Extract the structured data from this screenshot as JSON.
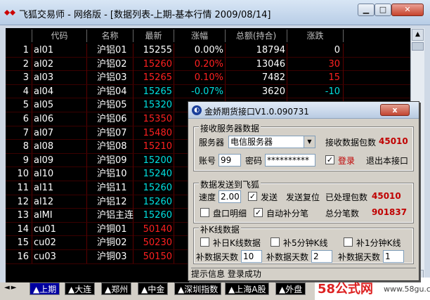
{
  "window": {
    "title": "飞狐交易师 - 网络版 - [数据列表-上期-基本行情 2009/08/14]",
    "min_icon": "minimize-icon",
    "max_icon": "maximize-icon",
    "close_icon": "close-icon"
  },
  "table": {
    "headers": [
      "",
      "代码",
      "名称",
      "最新",
      "涨幅",
      "总额(持合)",
      "涨跌",
      ""
    ],
    "rows": [
      {
        "n": "1",
        "code": "al01",
        "name": "沪铝01",
        "last": "15255",
        "chg_pct": "0.00%",
        "amount": "18794",
        "chg": "0",
        "dir": "flat"
      },
      {
        "n": "2",
        "code": "al02",
        "name": "沪铝02",
        "last": "15260",
        "chg_pct": "0.20%",
        "amount": "13046",
        "chg": "30",
        "dir": "up"
      },
      {
        "n": "3",
        "code": "al03",
        "name": "沪铝03",
        "last": "15265",
        "chg_pct": "0.10%",
        "amount": "7482",
        "chg": "15",
        "dir": "up"
      },
      {
        "n": "4",
        "code": "al04",
        "name": "沪铝04",
        "last": "15265",
        "chg_pct": "-0.07%",
        "amount": "3620",
        "chg": "-10",
        "dir": "down"
      },
      {
        "n": "5",
        "code": "al05",
        "name": "沪铝05",
        "last": "15320",
        "chg_pct": "",
        "amount": "",
        "chg": "",
        "dir": "down"
      },
      {
        "n": "6",
        "code": "al06",
        "name": "沪铝06",
        "last": "15350",
        "chg_pct": "",
        "amount": "",
        "chg": "",
        "dir": "up"
      },
      {
        "n": "7",
        "code": "al07",
        "name": "沪铝07",
        "last": "15480",
        "chg_pct": "",
        "amount": "",
        "chg": "",
        "dir": "up"
      },
      {
        "n": "8",
        "code": "al08",
        "name": "沪铝08",
        "last": "15210",
        "chg_pct": "",
        "amount": "",
        "chg": "",
        "dir": "up"
      },
      {
        "n": "9",
        "code": "al09",
        "name": "沪铝09",
        "last": "15200",
        "chg_pct": "",
        "amount": "",
        "chg": "",
        "dir": "down"
      },
      {
        "n": "10",
        "code": "al10",
        "name": "沪铝10",
        "last": "15240",
        "chg_pct": "",
        "amount": "",
        "chg": "",
        "dir": "down"
      },
      {
        "n": "11",
        "code": "al11",
        "name": "沪铝11",
        "last": "15260",
        "chg_pct": "",
        "amount": "",
        "chg": "",
        "dir": "down"
      },
      {
        "n": "12",
        "code": "al12",
        "name": "沪铝12",
        "last": "15260",
        "chg_pct": "",
        "amount": "",
        "chg": "",
        "dir": "down"
      },
      {
        "n": "13",
        "code": "alMI",
        "name": "沪铝主连",
        "last": "15260",
        "chg_pct": "",
        "amount": "",
        "chg": "",
        "dir": "down"
      },
      {
        "n": "14",
        "code": "cu01",
        "name": "沪铜01",
        "last": "50140",
        "chg_pct": "",
        "amount": "",
        "chg": "",
        "dir": "up"
      },
      {
        "n": "15",
        "code": "cu02",
        "name": "沪铜02",
        "last": "50230",
        "chg_pct": "",
        "amount": "",
        "chg": "",
        "dir": "up"
      },
      {
        "n": "16",
        "code": "cu03",
        "name": "沪铜03",
        "last": "50150",
        "chg_pct": "",
        "amount": "",
        "chg": "",
        "dir": "up"
      }
    ]
  },
  "tabs": [
    "上期",
    "大连",
    "郑州",
    "中金",
    "深圳指数",
    "上海A股",
    "外盘"
  ],
  "tab_nav": "◄►",
  "watermark": {
    "logo": "58公式网",
    "url": "www.58gu.com"
  },
  "dialog": {
    "title": "金娇期货接口V1.0.090731",
    "close_label": "x",
    "recv": {
      "legend": "接收服务器数据",
      "server_label": "服务器",
      "server_value": "电信服务器",
      "packets_label": "接收数据包数",
      "packets_value": "45010",
      "account_label": "账号",
      "account_value": "99",
      "password_label": "密码",
      "password_value": "**********",
      "login_label": "登录",
      "exit_label": "退出本接口"
    },
    "send": {
      "legend": "数据发送到飞狐",
      "speed_label": "速度",
      "speed_value": "2.00",
      "send_label": "发送",
      "reset_label": "发送复位",
      "processed_label": "已处理包数",
      "processed_value": "45010",
      "detail_label": "盘口明细",
      "auto_label": "自动补分笔",
      "total_label": "总分笔数",
      "total_value": "901837"
    },
    "kline": {
      "legend": "补K线数据",
      "daily_label": "补日K线数据",
      "min5_label": "补5分钟K线",
      "min1_label": "补1分钟K线",
      "days_label": "补数据天数",
      "days1": "10",
      "days2": "2",
      "days3": "1"
    },
    "status": "提示信息 登录成功"
  },
  "colors": {
    "up": "#ff2020",
    "down": "#00e0e0",
    "flat": "#ffffff"
  }
}
